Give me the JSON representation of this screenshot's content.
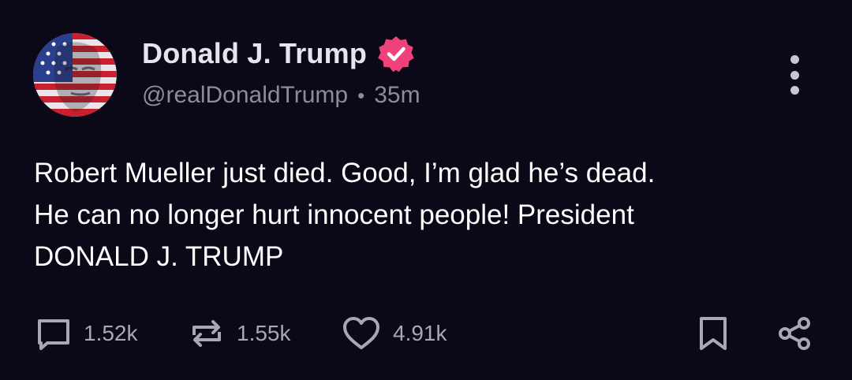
{
  "author": {
    "display_name": "Donald J. Trump",
    "handle": "@realDonaldTrump",
    "separator": "•",
    "time_ago": "35m",
    "verified": true,
    "avatar_icon": "flag-portrait-avatar"
  },
  "post": {
    "text": "Robert Mueller just died. Good, I’m glad he’s dead.\nHe can no longer hurt innocent people! President\nDONALD J. TRUMP"
  },
  "actions": {
    "replies": "1.52k",
    "reposts": "1.55k",
    "likes": "4.91k",
    "reply_icon": "comment-icon",
    "repost_icon": "repost-icon",
    "like_icon": "heart-icon",
    "bookmark_icon": "bookmark-icon",
    "share_icon": "share-icon"
  },
  "colors": {
    "background": "#0b0817",
    "verified_badge": "#f0427a",
    "muted_text": "#8e8b9c",
    "icon": "#a9a6b6"
  }
}
